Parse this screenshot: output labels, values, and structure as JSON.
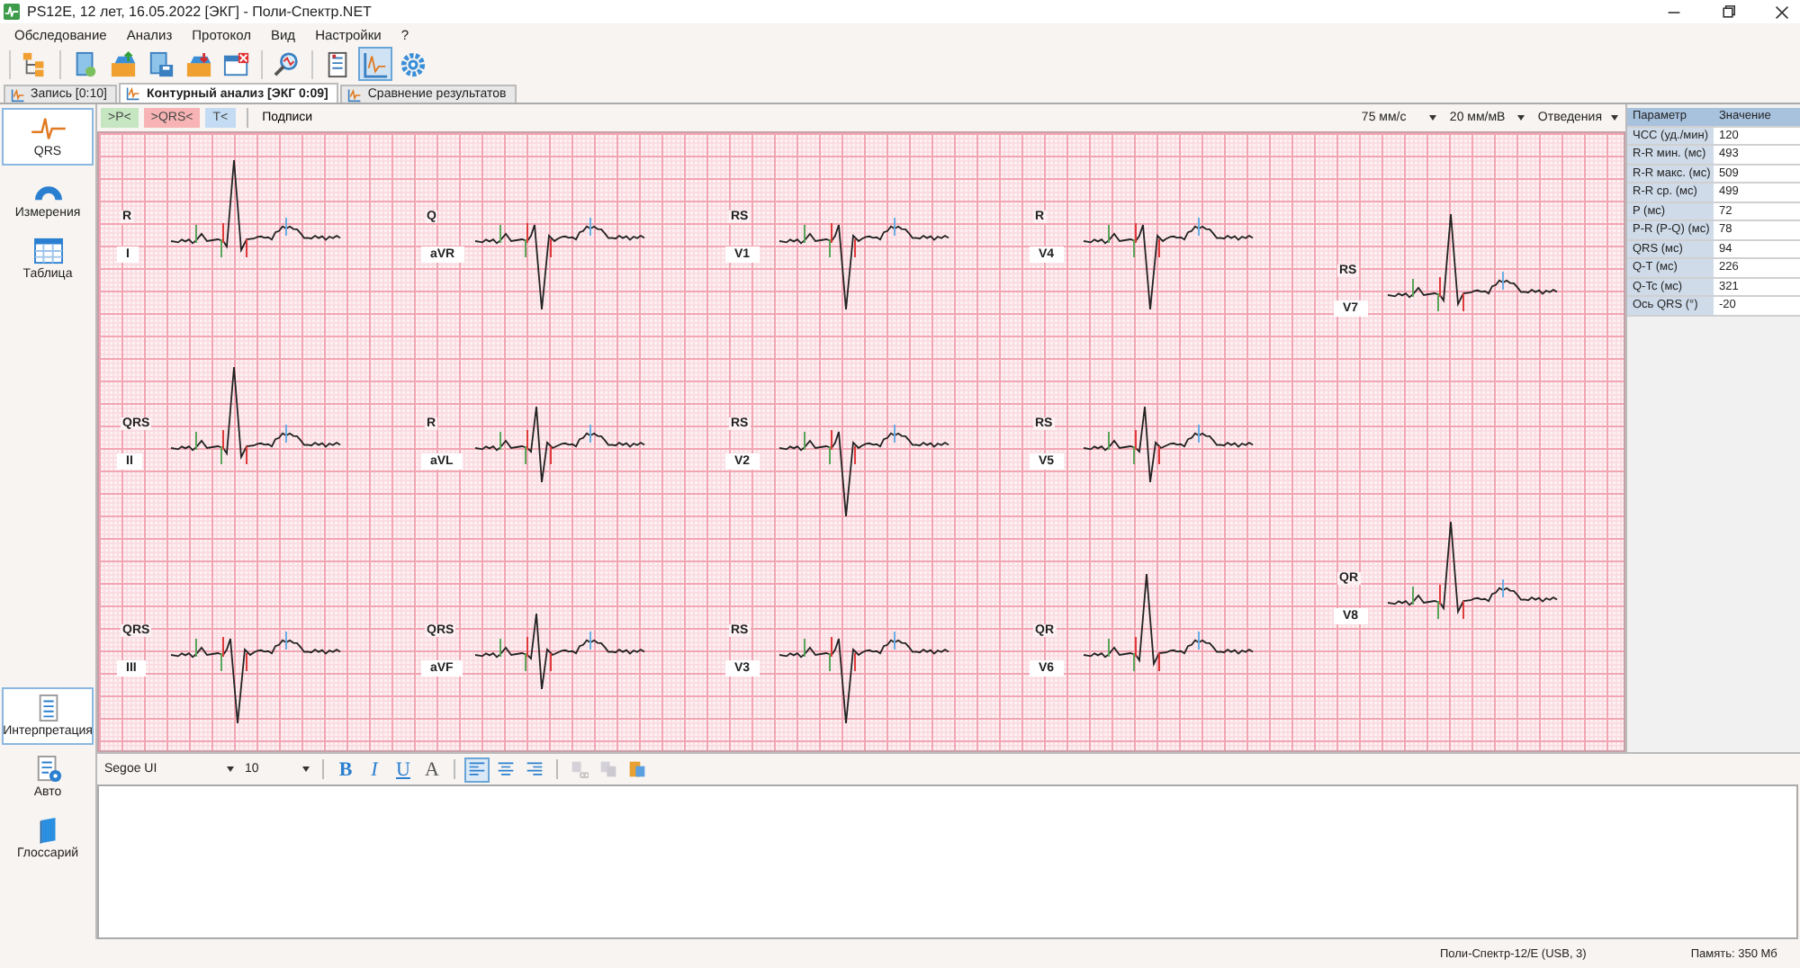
{
  "window": {
    "title": "PS12E, 12 лет, 16.05.2022 [ЭКГ] - Поли-Спектр.NET"
  },
  "menu": [
    "Обследование",
    "Анализ",
    "Протокол",
    "Вид",
    "Настройки",
    "?"
  ],
  "toolbar": [
    [
      {
        "kind": "tree",
        "selected": false
      }
    ],
    [
      {
        "kind": "open",
        "selected": false
      },
      {
        "kind": "import",
        "selected": false
      },
      {
        "kind": "save",
        "selected": false
      },
      {
        "kind": "export",
        "selected": false
      },
      {
        "kind": "close",
        "selected": false
      }
    ],
    [
      {
        "kind": "search",
        "selected": false
      }
    ],
    [
      {
        "kind": "report",
        "selected": false
      },
      {
        "kind": "chart",
        "selected": true
      },
      {
        "kind": "settings",
        "selected": false
      }
    ]
  ],
  "tabs": [
    {
      "label": "Запись [0:10]",
      "selected": false
    },
    {
      "label": "Контурный анализ [ЭКГ 0:09]",
      "selected": true
    },
    {
      "label": "Сравнение результатов",
      "selected": false
    }
  ],
  "sidebar": {
    "top": [
      {
        "label": "QRS",
        "kind": "qrs",
        "selected": true
      },
      {
        "label": "Измерения",
        "kind": "protractor",
        "selected": false
      },
      {
        "label": "Таблица",
        "kind": "table",
        "selected": false
      }
    ],
    "bottom": [
      {
        "label": "Интерпретация",
        "kind": "document",
        "selected": true
      },
      {
        "label": "Авто",
        "kind": "auto",
        "selected": false
      },
      {
        "label": "Глоссарий",
        "kind": "book",
        "selected": false
      }
    ]
  },
  "ecg_toolbar": {
    "markers": [
      {
        "label": ">P<",
        "color": "#c6e6c2"
      },
      {
        "label": ">QRS<",
        "color": "#f8b4b4"
      },
      {
        "label": "T<",
        "color": "#c3dcf3"
      }
    ],
    "labels_button": "Подписи",
    "speed": "75 мм/с",
    "gain": "20 мм/мВ",
    "leads_menu": "Отведения"
  },
  "leads": [
    {
      "name": "I",
      "morphology": "R",
      "kind": "positive"
    },
    {
      "name": "II",
      "morphology": "QRS",
      "kind": "positive"
    },
    {
      "name": "III",
      "morphology": "QRS",
      "kind": "negative"
    },
    {
      "name": "aVR",
      "morphology": "Q",
      "kind": "negative"
    },
    {
      "name": "aVL",
      "morphology": "R",
      "kind": "biphasic"
    },
    {
      "name": "aVF",
      "morphology": "QRS",
      "kind": "biphasic"
    },
    {
      "name": "V1",
      "morphology": "RS",
      "kind": "negative"
    },
    {
      "name": "V2",
      "morphology": "RS",
      "kind": "negative"
    },
    {
      "name": "V3",
      "morphology": "RS",
      "kind": "negative"
    },
    {
      "name": "V4",
      "morphology": "R",
      "kind": "negative"
    },
    {
      "name": "V5",
      "morphology": "RS",
      "kind": "biphasic"
    },
    {
      "name": "V6",
      "morphology": "QR",
      "kind": "positive"
    },
    {
      "name": "V7",
      "morphology": "RS",
      "kind": "positive"
    },
    {
      "name": "V8",
      "morphology": "QR",
      "kind": "positive"
    }
  ],
  "params": {
    "columns": [
      "Параметр",
      "Значение"
    ],
    "rows": [
      {
        "name": "ЧСС (уд./мин)",
        "value": "120"
      },
      {
        "name": "R-R мин. (мс)",
        "value": "493"
      },
      {
        "name": "R-R макс. (мс)",
        "value": "509"
      },
      {
        "name": "R-R ср. (мс)",
        "value": "499"
      },
      {
        "name": "P (мс)",
        "value": "72"
      },
      {
        "name": "P-R (P-Q) (мс)",
        "value": "78"
      },
      {
        "name": "QRS (мс)",
        "value": "94"
      },
      {
        "name": "Q-T (мс)",
        "value": "226"
      },
      {
        "name": "Q-Tc (мс)",
        "value": "321"
      },
      {
        "name": "Ось QRS (°)",
        "value": "-20"
      }
    ]
  },
  "editor": {
    "font": "Segoe UI",
    "size": "10",
    "format": [
      {
        "kind": "bold",
        "label": "B"
      },
      {
        "kind": "italic",
        "label": "I"
      },
      {
        "kind": "underline",
        "label": "U"
      },
      {
        "kind": "color",
        "label": "A"
      }
    ],
    "align": [
      {
        "kind": "left",
        "selected": true
      },
      {
        "kind": "center",
        "selected": false
      },
      {
        "kind": "right",
        "selected": false
      }
    ],
    "clipboard": [
      {
        "kind": "cut",
        "disabled": true
      },
      {
        "kind": "copy",
        "disabled": true
      },
      {
        "kind": "paste",
        "disabled": false
      }
    ]
  },
  "status": [
    "Поли-Спектр-12/E (USB, 3)",
    "Память: 350 Мб"
  ]
}
